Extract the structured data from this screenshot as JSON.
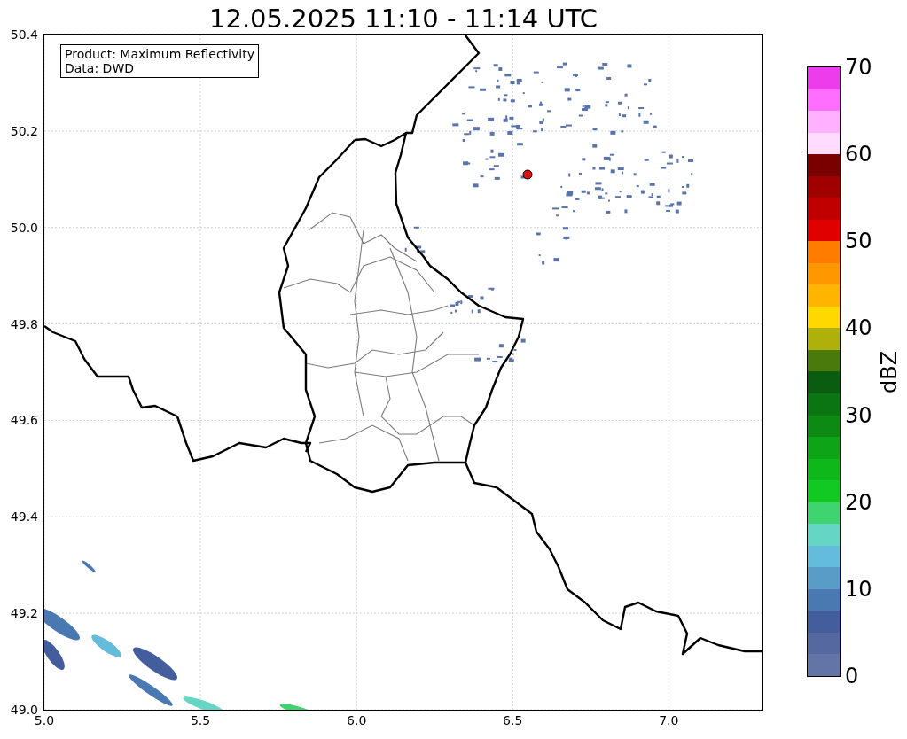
{
  "title": "12.05.2025 11:10 - 11:14 UTC",
  "map": {
    "legend": [
      "Product: Maximum Reflectivity",
      "Data: DWD"
    ],
    "x_ticks": [
      "5.0",
      "5.5",
      "6.0",
      "6.5",
      "7.0"
    ],
    "y_ticks": [
      "50.4",
      "50.2",
      "50.0",
      "49.8",
      "49.6",
      "49.4",
      "49.2",
      "49.0"
    ]
  },
  "colorbar": {
    "label": "dBZ",
    "ticks": [
      "70",
      "60",
      "50",
      "40",
      "30",
      "20",
      "10",
      "0"
    ],
    "segments": [
      {
        "color": "#ec3cec"
      },
      {
        "color": "#ff6eff"
      },
      {
        "color": "#ffb0ff"
      },
      {
        "color": "#ffdcff"
      },
      {
        "color": "#7a0000"
      },
      {
        "color": "#a00000"
      },
      {
        "color": "#c00000"
      },
      {
        "color": "#e00000"
      },
      {
        "color": "#ff7c00"
      },
      {
        "color": "#ff9800"
      },
      {
        "color": "#ffb400"
      },
      {
        "color": "#ffd800"
      },
      {
        "color": "#afb00a"
      },
      {
        "color": "#4a7a0c"
      },
      {
        "color": "#0a5c10"
      },
      {
        "color": "#0b7512"
      },
      {
        "color": "#0c8a14"
      },
      {
        "color": "#0ea418"
      },
      {
        "color": "#0fb81a"
      },
      {
        "color": "#12c822"
      },
      {
        "color": "#3ed470"
      },
      {
        "color": "#66d6c4"
      },
      {
        "color": "#64bcdc"
      },
      {
        "color": "#5a9cc8"
      },
      {
        "color": "#4a78b0"
      },
      {
        "color": "#445d9c"
      },
      {
        "color": "#55689f"
      },
      {
        "color": "#6374a6"
      }
    ]
  }
}
